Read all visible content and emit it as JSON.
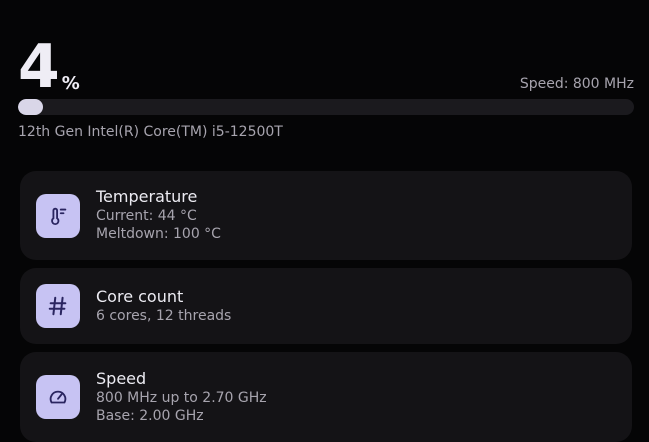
{
  "usage": {
    "value": "4",
    "unit": "%",
    "fraction": 0.04
  },
  "speed_text": "Speed: 800 MHz",
  "cpu_name": "12th Gen Intel(R) Core(TM) i5-12500T",
  "cards": [
    {
      "icon": "thermometer-icon",
      "title": "Temperature",
      "lines": [
        "Current: 44 °C",
        "Meltdown: 100 °C"
      ]
    },
    {
      "icon": "hash-icon",
      "title": "Core count",
      "lines": [
        "6 cores, 12 threads"
      ]
    },
    {
      "icon": "speedometer-icon",
      "title": "Speed",
      "lines": [
        "800 MHz up to 2.70 GHz",
        "Base: 2.00 GHz"
      ]
    }
  ],
  "colors": {
    "background": "#050506",
    "card": "#141316",
    "icon_bg": "#c7c3f3",
    "progress_fill": "#d9d6e8",
    "progress_track": "#1b1a1e"
  }
}
